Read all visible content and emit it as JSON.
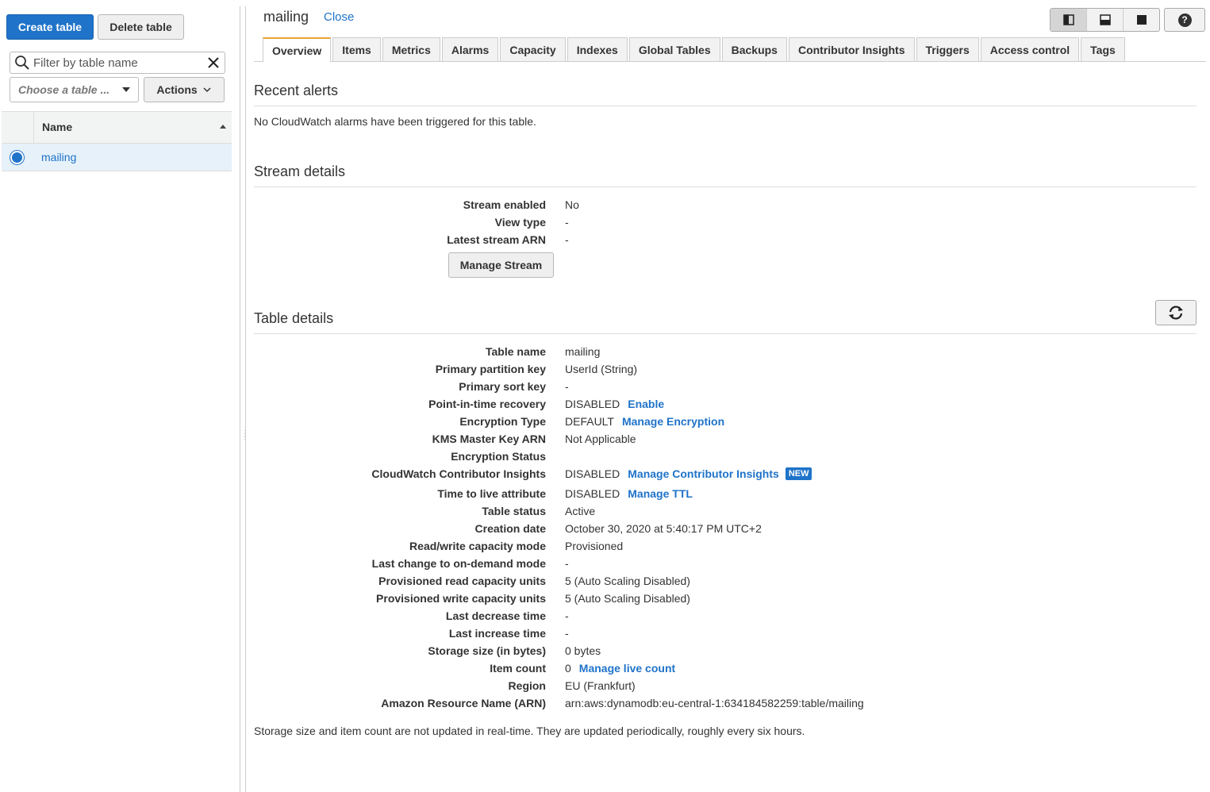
{
  "left": {
    "create_table": "Create table",
    "delete_table": "Delete table",
    "filter_placeholder": "Filter by table name",
    "choose_placeholder": "Choose a table ...",
    "actions": "Actions",
    "column_name": "Name",
    "rows": [
      {
        "name": "mailing",
        "selected": true
      }
    ]
  },
  "header": {
    "title": "mailing",
    "close": "Close"
  },
  "tabs": [
    "Overview",
    "Items",
    "Metrics",
    "Alarms",
    "Capacity",
    "Indexes",
    "Global Tables",
    "Backups",
    "Contributor Insights",
    "Triggers",
    "Access control",
    "Tags"
  ],
  "recent_alerts": {
    "heading": "Recent alerts",
    "message": "No CloudWatch alarms have been triggered for this table."
  },
  "stream": {
    "heading": "Stream details",
    "rows": [
      {
        "label": "Stream enabled",
        "value": "No"
      },
      {
        "label": "View type",
        "value": "-"
      },
      {
        "label": "Latest stream ARN",
        "value": "-"
      }
    ],
    "manage_button": "Manage Stream"
  },
  "table_details": {
    "heading": "Table details",
    "rows": [
      {
        "label": "Table name",
        "value": "mailing"
      },
      {
        "label": "Primary partition key",
        "value": "UserId (String)"
      },
      {
        "label": "Primary sort key",
        "value": "-"
      },
      {
        "label": "Point-in-time recovery",
        "value": "DISABLED",
        "link": "Enable"
      },
      {
        "label": "Encryption Type",
        "value": "DEFAULT",
        "link": "Manage Encryption"
      },
      {
        "label": "KMS Master Key ARN",
        "value": "Not Applicable"
      },
      {
        "label": "Encryption Status",
        "value": ""
      },
      {
        "label": "CloudWatch Contributor Insights",
        "value": "DISABLED",
        "link": "Manage Contributor Insights",
        "badge": "NEW"
      },
      {
        "label": "Time to live attribute",
        "value": "DISABLED",
        "link": "Manage TTL"
      },
      {
        "label": "Table status",
        "value": "Active"
      },
      {
        "label": "Creation date",
        "value": "October 30, 2020 at 5:40:17 PM UTC+2"
      },
      {
        "label": "Read/write capacity mode",
        "value": "Provisioned"
      },
      {
        "label": "Last change to on-demand mode",
        "value": "-"
      },
      {
        "label": "Provisioned read capacity units",
        "value": "5 (Auto Scaling Disabled)"
      },
      {
        "label": "Provisioned write capacity units",
        "value": "5 (Auto Scaling Disabled)"
      },
      {
        "label": "Last decrease time",
        "value": "-"
      },
      {
        "label": "Last increase time",
        "value": "-"
      },
      {
        "label": "Storage size (in bytes)",
        "value": "0 bytes"
      },
      {
        "label": "Item count",
        "value": "0",
        "link": "Manage live count"
      },
      {
        "label": "Region",
        "value": "EU (Frankfurt)"
      },
      {
        "label": "Amazon Resource Name (ARN)",
        "value": "arn:aws:dynamodb:eu-central-1:634184582259:table/mailing"
      }
    ],
    "footnote": "Storage size and item count are not updated in real-time. They are updated periodically, roughly every six hours."
  }
}
